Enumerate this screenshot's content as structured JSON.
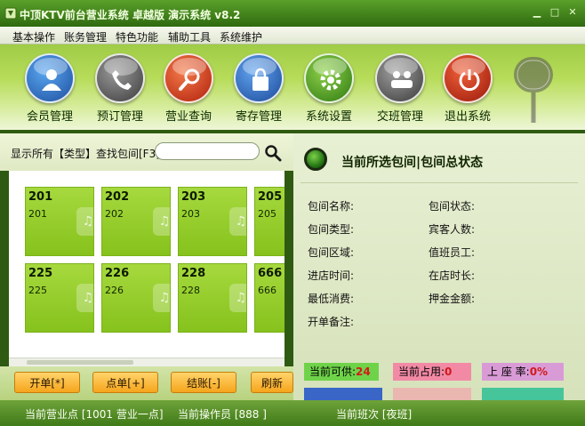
{
  "window": {
    "title": "中顶KTV前台营业系统 卓越版 演示系统 v8.2",
    "minimize": "▁",
    "maximize": "□",
    "close": "✕"
  },
  "menu": [
    "基本操作",
    "账务管理",
    "特色功能",
    "辅助工具",
    "系统维护"
  ],
  "toolbar": [
    {
      "label": "会员管理",
      "icon": "member-icon",
      "color": "#2a6cc8"
    },
    {
      "label": "预订管理",
      "icon": "phone-icon",
      "color": "#5a5a5a"
    },
    {
      "label": "营业查询",
      "icon": "magnifier-icon",
      "color": "#d63a1a"
    },
    {
      "label": "寄存管理",
      "icon": "bag-icon",
      "color": "#2b64b8"
    },
    {
      "label": "系统设置",
      "icon": "gear-icon",
      "color": "#4e9a1e"
    },
    {
      "label": "交班管理",
      "icon": "handover-icon",
      "color": "#5a5a5a"
    },
    {
      "label": "退出系统",
      "icon": "exit-icon",
      "color": "#c82a1a"
    }
  ],
  "search": {
    "label": "显示所有【类型】查找包间[F3]",
    "value": "",
    "placeholder": ""
  },
  "rooms": [
    {
      "number": "201",
      "name": "201"
    },
    {
      "number": "202",
      "name": "202"
    },
    {
      "number": "203",
      "name": "203"
    },
    {
      "number": "205",
      "name": "205"
    },
    {
      "number": "225",
      "name": "225"
    },
    {
      "number": "226",
      "name": "226"
    },
    {
      "number": "228",
      "name": "228"
    },
    {
      "number": "666",
      "name": "666"
    }
  ],
  "actions": {
    "open": "开单[*]",
    "order": "点单[+]",
    "checkout": "结账[-]",
    "refresh": "刷新"
  },
  "panel": {
    "title": "当前所选包间|包间总状态",
    "fields": {
      "room_name": "包间名称:",
      "room_status": "包间状态:",
      "room_type": "包间类型:",
      "guest_count": "宾客人数:",
      "room_area": "包间区域:",
      "staff": "值班员工:",
      "enter_time": "进店时间:",
      "stay_time": "在店时长:",
      "min_consume": "最低消费:",
      "deposit": "押金金额:",
      "open_note": "开单备注:"
    }
  },
  "stats": {
    "available_label": "当前可供:",
    "available_value": "24",
    "occupied_label": "当前占用:",
    "occupied_value": "0",
    "rate_label": "上 座 率:",
    "rate_value": "0%",
    "colors": {
      "available": "#6fd34a",
      "occupied": "#f28aa6",
      "rate": "#d99bd6"
    }
  },
  "statusbar": {
    "business_point": "当前营业点 [1001 营业一点]",
    "operator": "当前操作员 [888 ]",
    "shift": "当前班次 [夜班]"
  }
}
